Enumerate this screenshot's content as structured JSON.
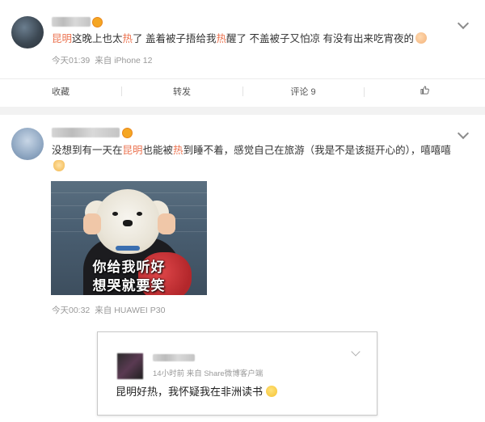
{
  "feed": {
    "posts": [
      {
        "text_parts": [
          "昆明",
          "这晚上也太",
          "热",
          "了 盖着被子捂给我",
          "热",
          "醒了 不盖被子又怕凉 有没有出来吃宵夜的"
        ],
        "time": "今天01:39",
        "device": "来自 iPhone 12",
        "actions": {
          "favorite": "收藏",
          "repost": "转发",
          "comment": "评论 9"
        }
      },
      {
        "text_line1_parts": [
          "没想到有一天在",
          "昆明",
          "也能被",
          "热",
          "到睡不着，感觉自己在旅游（我是不是该挺开心的），嘻嘻嘻"
        ],
        "meme_caption": [
          "你给我听好",
          "想哭就要笑"
        ],
        "time": "今天00:32",
        "device": "来自 HUAWEI P30"
      }
    ]
  },
  "reply": {
    "meta": "14小时前  来自 Share微博客户端",
    "text": "昆明好热，我怀疑我在非洲读书"
  },
  "colors": {
    "highlight": "#eb7350",
    "meta": "#999999",
    "separator": "#f2f2f2"
  },
  "icons": {
    "dropdown": "chevron-down-icon",
    "like": "thumbs-up-icon",
    "vip": "vip-badge-icon"
  }
}
